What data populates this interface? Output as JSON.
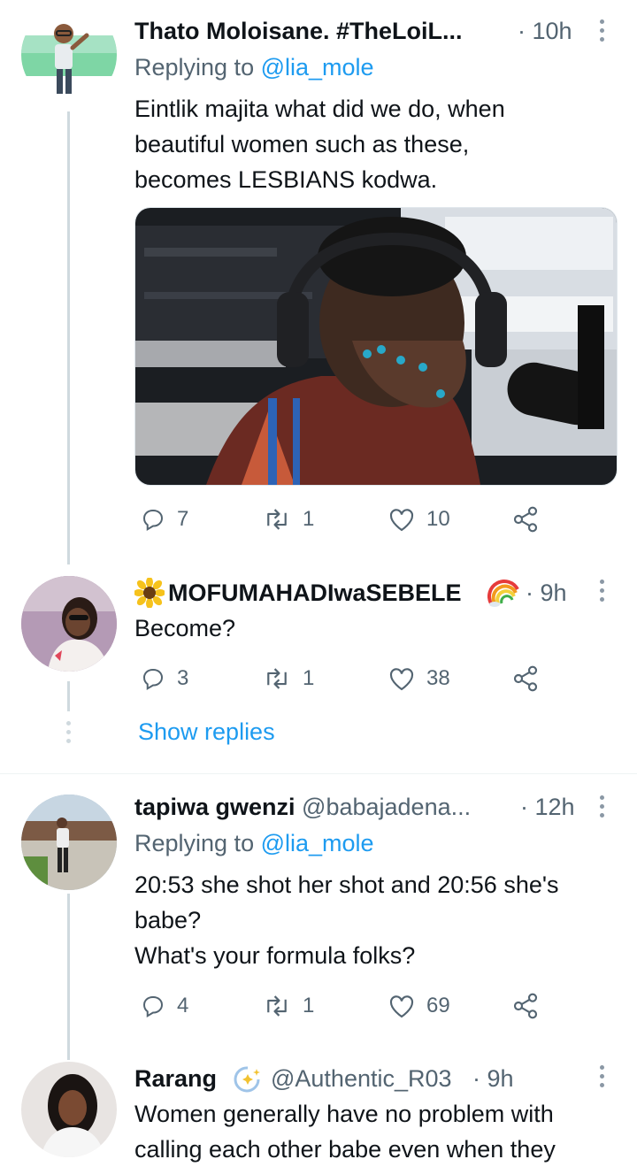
{
  "tweets": [
    {
      "name": "Thato Moloisane. #TheLoiL...",
      "time": "· 10h",
      "replying_prefix": "Replying to ",
      "replying_handle": "@lia_mole",
      "text": [
        "Eintlik majita what did we do, when",
        "beautiful women such as these,",
        "becomes LESBIANS kodwa."
      ],
      "replies": "7",
      "retweets": "1",
      "likes": "10"
    },
    {
      "name": "MOFUMAHADIwaSEBELE",
      "time": "· 9h",
      "text": [
        "Become?"
      ],
      "replies": "3",
      "retweets": "1",
      "likes": "38",
      "show_replies": "Show replies"
    },
    {
      "name": "tapiwa gwenzi",
      "handle": "@babajadena...",
      "time": "· 12h",
      "replying_prefix": "Replying to ",
      "replying_handle": "@lia_mole",
      "text": [
        "20:53 she shot her shot and 20:56 she's",
        "babe?",
        "What's your formula folks?"
      ],
      "replies": "4",
      "retweets": "1",
      "likes": "69"
    },
    {
      "name": "Rarang",
      "handle": "@Authentic_R03",
      "time": "· 9h",
      "text": [
        "Women generally have no problem with",
        "calling each other babe even when they"
      ]
    }
  ],
  "colors": {
    "accent": "#1d9bf0",
    "secondary": "#536471",
    "line": "#cfd9de"
  }
}
